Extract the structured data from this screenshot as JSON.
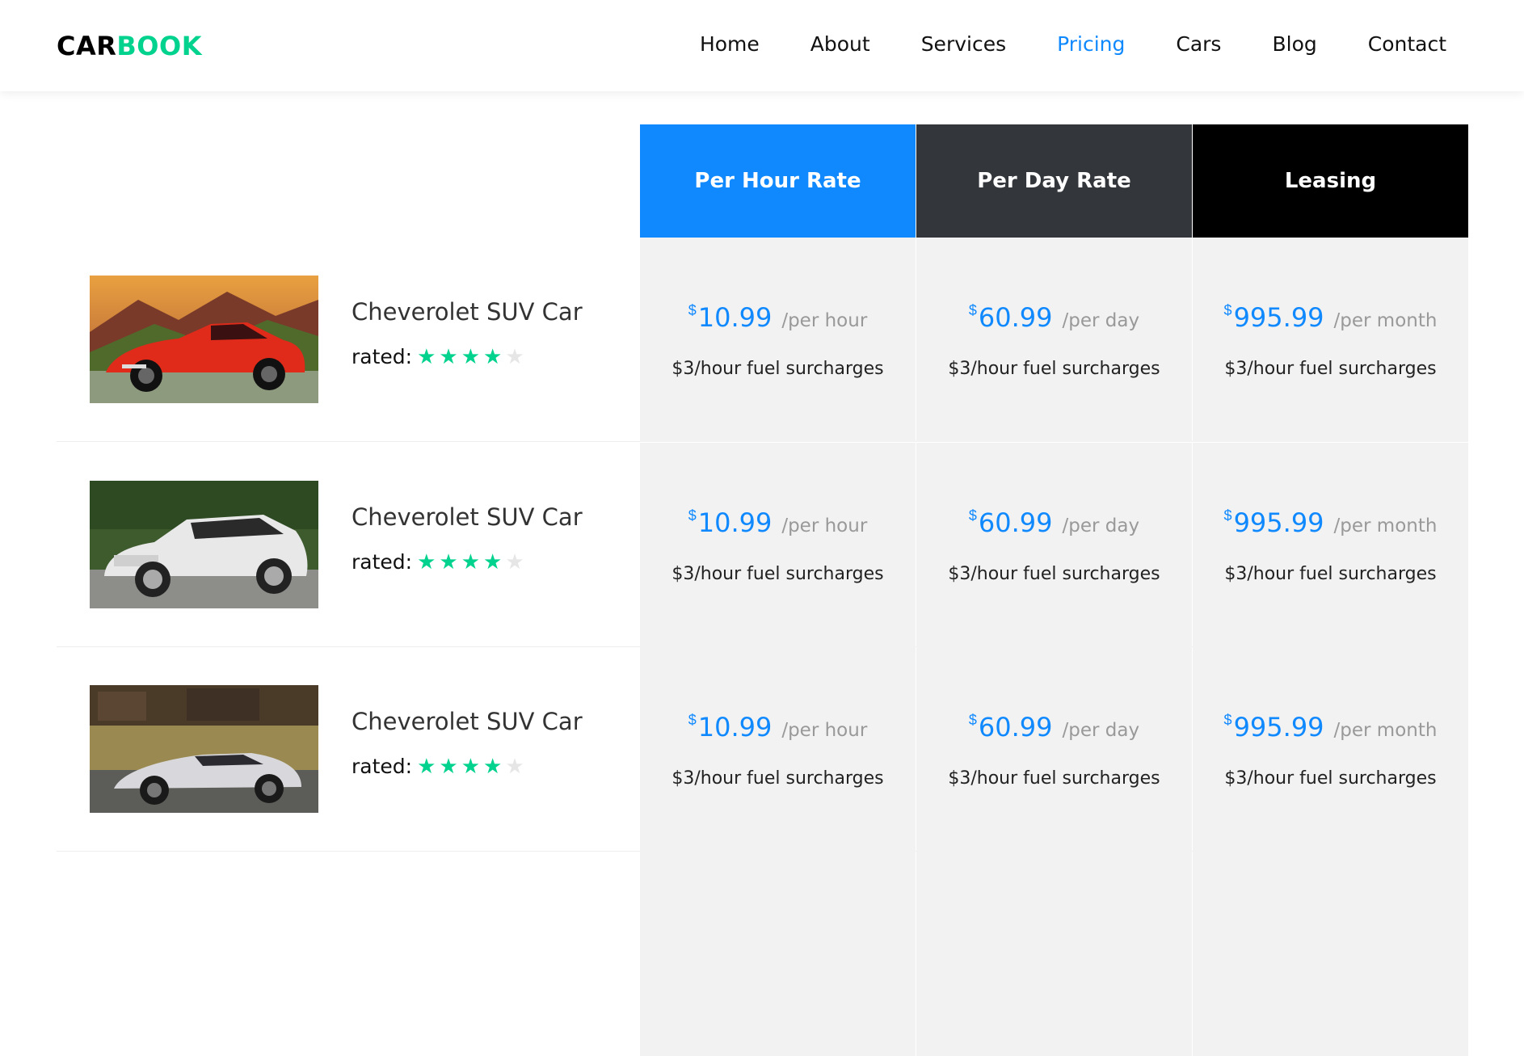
{
  "brand": {
    "part1": "CAR",
    "part2": "BOOK"
  },
  "nav": {
    "items": [
      "Home",
      "About",
      "Services",
      "Pricing",
      "Cars",
      "Blog",
      "Contact"
    ],
    "active": "Pricing"
  },
  "columns": [
    {
      "label": "Per Hour Rate",
      "color": "#1089ff"
    },
    {
      "label": "Per Day Rate",
      "color": "#33363b"
    },
    {
      "label": "Leasing",
      "color": "#000000"
    }
  ],
  "rated_label": "rated:",
  "rows": [
    {
      "car_name": "Cheverolet SUV Car",
      "image": "red-convertible",
      "rating": 4,
      "rating_max": 5,
      "prices": [
        {
          "currency": "$",
          "amount": "10.99",
          "unit": "/per hour",
          "surcharge": "$3/hour fuel surcharges"
        },
        {
          "currency": "$",
          "amount": "60.99",
          "unit": "/per day",
          "surcharge": "$3/hour fuel surcharges"
        },
        {
          "currency": "$",
          "amount": "995.99",
          "unit": "/per month",
          "surcharge": "$3/hour fuel surcharges"
        }
      ]
    },
    {
      "car_name": "Cheverolet SUV Car",
      "image": "white-suv",
      "rating": 4,
      "rating_max": 5,
      "prices": [
        {
          "currency": "$",
          "amount": "10.99",
          "unit": "/per hour",
          "surcharge": "$3/hour fuel surcharges"
        },
        {
          "currency": "$",
          "amount": "60.99",
          "unit": "/per day",
          "surcharge": "$3/hour fuel surcharges"
        },
        {
          "currency": "$",
          "amount": "995.99",
          "unit": "/per month",
          "surcharge": "$3/hour fuel surcharges"
        }
      ]
    },
    {
      "car_name": "Cheverolet SUV Car",
      "image": "silver-supercar",
      "rating": 4,
      "rating_max": 5,
      "prices": [
        {
          "currency": "$",
          "amount": "10.99",
          "unit": "/per hour",
          "surcharge": "$3/hour fuel surcharges"
        },
        {
          "currency": "$",
          "amount": "60.99",
          "unit": "/per day",
          "surcharge": "$3/hour fuel surcharges"
        },
        {
          "currency": "$",
          "amount": "995.99",
          "unit": "/per month",
          "surcharge": "$3/hour fuel surcharges"
        }
      ]
    }
  ],
  "colors": {
    "accent": "#1089ff",
    "brand_green": "#01d28e",
    "cell_bg": "#f2f2f2"
  }
}
